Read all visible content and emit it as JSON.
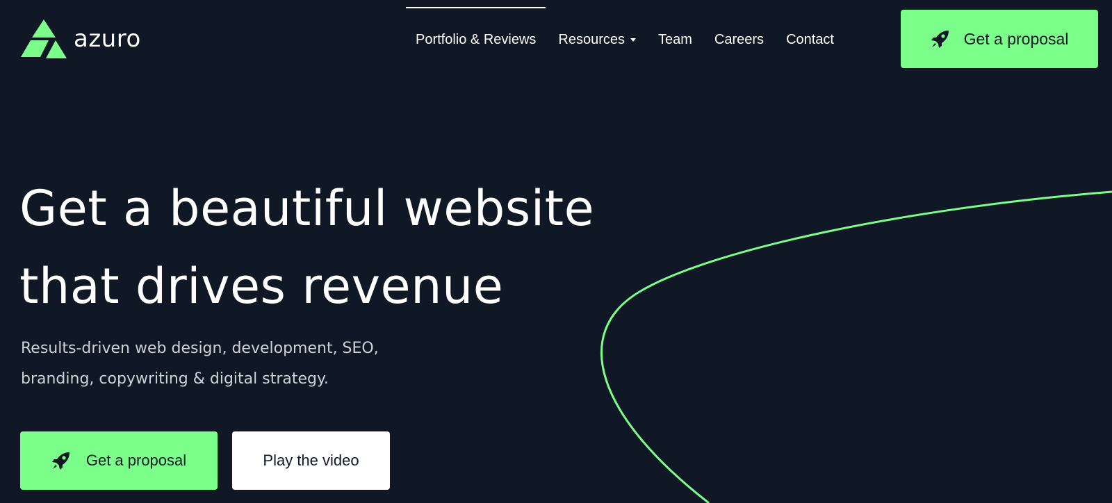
{
  "brand": {
    "name": "azuro",
    "accent_color": "#7bff8a",
    "background_color": "#0f1824"
  },
  "nav": {
    "items": [
      {
        "label": "Portfolio & Reviews",
        "active": true
      },
      {
        "label": "Resources",
        "has_dropdown": true
      },
      {
        "label": "Team"
      },
      {
        "label": "Careers"
      },
      {
        "label": "Contact"
      }
    ]
  },
  "header": {
    "cta_label": "Get a proposal",
    "cta_icon": "rocket-icon"
  },
  "hero": {
    "title_line_1": "Get a beautiful website",
    "title_line_2": "that drives revenue",
    "subtitle_line_1": "Results-driven web design, development, SEO,",
    "subtitle_line_2": "branding, copywriting & digital strategy.",
    "primary_cta_label": "Get a proposal",
    "primary_cta_icon": "rocket-icon",
    "secondary_cta_label": "Play the video"
  }
}
